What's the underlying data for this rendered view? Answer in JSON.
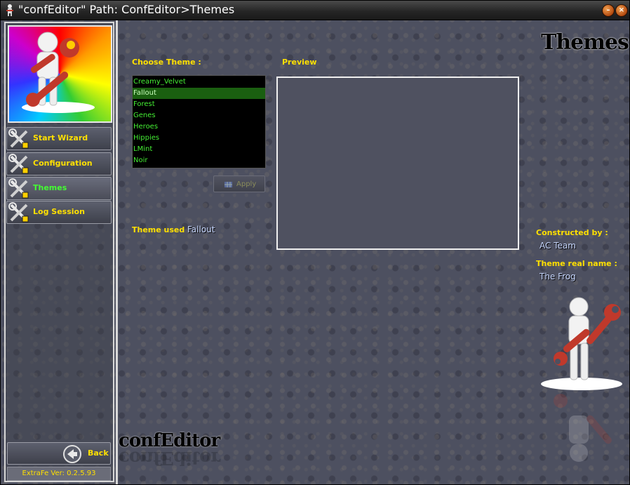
{
  "window": {
    "title": "\"confEditor\"   Path: ConfEditor>Themes"
  },
  "sidebar": {
    "items": [
      {
        "label": "Start Wizard",
        "icon": "wrench-screwdriver-icon",
        "active": false
      },
      {
        "label": "Configuration",
        "icon": "wrench-screwdriver-icon",
        "active": false
      },
      {
        "label": "Themes",
        "icon": "wrench-screwdriver-icon",
        "active": true
      },
      {
        "label": "Log Session",
        "icon": "wrench-screwdriver-icon",
        "active": false
      }
    ],
    "back_label": "Back",
    "version": "ExtraFe Ver: 0.2.5.93"
  },
  "page": {
    "title": "Themes",
    "brand": "confEditor"
  },
  "choose_theme": {
    "label": "Choose Theme :",
    "themes": [
      "Creamy_Velvet",
      "Fallout",
      "Forest",
      "Genes",
      "Heroes",
      "Hippies",
      "LMint",
      "Noir"
    ],
    "selected": "Fallout",
    "apply_label": "Apply"
  },
  "preview": {
    "label": "Preview"
  },
  "theme_used": {
    "label": "Theme used :",
    "value": "Fallout"
  },
  "info": {
    "constructed_label": "Constructed by :",
    "constructed_value": "AC Team",
    "real_name_label": "Theme real name :",
    "real_name_value": "The Frog"
  },
  "colors": {
    "accent_yellow": "#ffe000",
    "list_green": "#44ee33",
    "selected_bg": "#1a5f10",
    "background": "#4d5060"
  }
}
